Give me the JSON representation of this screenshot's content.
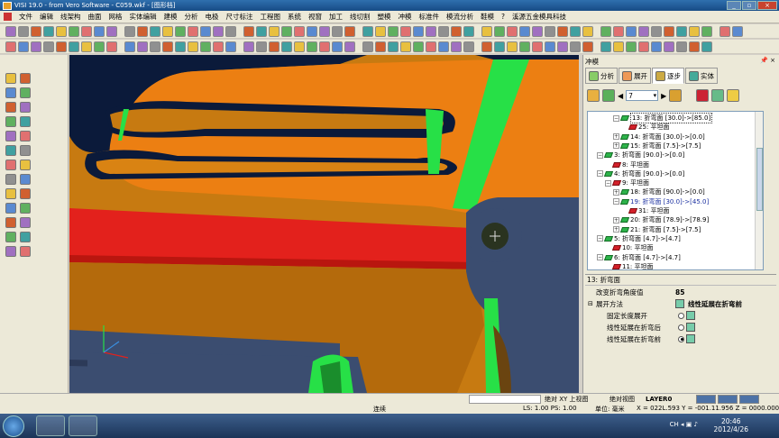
{
  "window": {
    "title": "VISI 19.0 - from Vero Software - C059.wkf - [图形档]",
    "buttons": [
      "_",
      "▫",
      "×"
    ]
  },
  "menu": {
    "items": [
      "文件",
      "编辑",
      "线架构",
      "曲面",
      "网格",
      "实体编辑",
      "建模",
      "分析",
      "电极",
      "尺寸标注",
      "工程图",
      "系统",
      "视窗",
      "加工",
      "线切割",
      "塑模",
      "冲模",
      "标准件",
      "模流分析",
      "鞋模",
      "?",
      "溪源五金模具科技"
    ]
  },
  "panel": {
    "title": "冲模",
    "pin": "📌 ×",
    "tabs": [
      {
        "label": "分析",
        "active": false
      },
      {
        "label": "展开",
        "active": false
      },
      {
        "label": "逐步",
        "active": true
      },
      {
        "label": "实体",
        "active": false
      }
    ],
    "step_value": "7"
  },
  "tree": {
    "rows": [
      {
        "label": "13: 折弯面 [30.0]->[85.0]",
        "icon": "green",
        "pm": "−",
        "indent": 4,
        "selected": true
      },
      {
        "label": "25: 平坦面",
        "icon": "red",
        "pm": "",
        "indent": 5
      },
      {
        "label": "14: 折弯面 [30.0]->[0.0]",
        "icon": "green",
        "pm": "+",
        "indent": 4
      },
      {
        "label": "15: 折弯面 [7.5]->[7.5]",
        "icon": "green",
        "pm": "+",
        "indent": 4
      },
      {
        "label": "3: 折弯面 [90.0]->[0.0]",
        "icon": "green",
        "pm": "−",
        "indent": 2
      },
      {
        "label": "8: 平坦面",
        "icon": "red",
        "pm": "",
        "indent": 3
      },
      {
        "label": "4: 折弯面 [90.0]->[0.0]",
        "icon": "green",
        "pm": "−",
        "indent": 2
      },
      {
        "label": "9: 平坦面",
        "icon": "red",
        "pm": "−",
        "indent": 3
      },
      {
        "label": "18: 折弯面 [90.0]->[0.0]",
        "icon": "green",
        "pm": "+",
        "indent": 4
      },
      {
        "label": "19: 折弯面 [30.0]->[45.0]",
        "icon": "green",
        "pm": "−",
        "indent": 4,
        "highlight": true
      },
      {
        "label": "31: 平坦面",
        "icon": "red",
        "pm": "",
        "indent": 5
      },
      {
        "label": "20: 折弯面 [78.9]->[78.9]",
        "icon": "green",
        "pm": "+",
        "indent": 4
      },
      {
        "label": "21: 折弯面 [7.5]->[7.5]",
        "icon": "green",
        "pm": "+",
        "indent": 4
      },
      {
        "label": "5: 折弯面 [4.7]->[4.7]",
        "icon": "green",
        "pm": "−",
        "indent": 2
      },
      {
        "label": "10: 平坦面",
        "icon": "red",
        "pm": "",
        "indent": 3
      },
      {
        "label": "6: 折弯面 [4.7]->[4.7]",
        "icon": "green",
        "pm": "−",
        "indent": 2
      },
      {
        "label": "11: 平坦面",
        "icon": "red",
        "pm": "",
        "indent": 3
      }
    ]
  },
  "props": {
    "header": "13: 折弯面",
    "angle_label": "改变折弯角度值",
    "angle_value": "85",
    "method_label": "展开方法",
    "method_selected": "线性延展在折弯前",
    "options": [
      {
        "label": "固定长度展开",
        "checked": false
      },
      {
        "label": "线性延展在折弯后",
        "checked": false
      },
      {
        "label": "线性延展在折弯前",
        "checked": true
      }
    ]
  },
  "status": {
    "view_label": "绝对 XY 上视图",
    "abs_view": "绝对视图",
    "layer": "LAYER0",
    "mode": "连续",
    "ls_ps": "LS: 1.00 PS: 1.00",
    "unit": "单位: 毫米",
    "coords": "X = 022L.593 Y = -001.11.956 Z = 0000.000",
    "time": "20:46",
    "date": "2012/4/26"
  },
  "colors": {
    "orange": "#ec7f12",
    "dark_orange": "#b46a0c",
    "red": "#e3211c",
    "green": "#27e047",
    "slate": "#3b4d70",
    "navy": "#0b1a3a"
  }
}
